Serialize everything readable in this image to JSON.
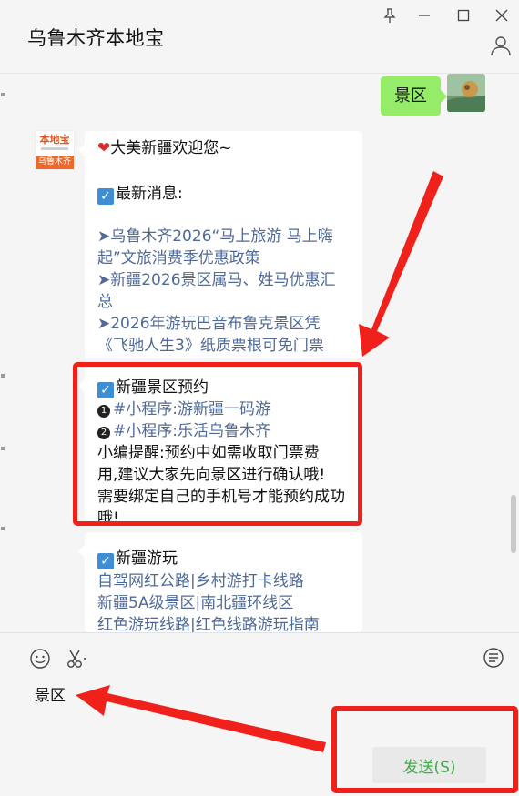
{
  "window": {
    "title": "乌鲁木齐本地宝",
    "controls": [
      "pin-icon",
      "minimize-icon",
      "maximize-icon",
      "close-icon"
    ]
  },
  "my_message": {
    "text": "景区"
  },
  "bot": {
    "avatar": {
      "top_text": "本地宝",
      "band_text": "乌鲁木齐"
    },
    "welcome": "大美新疆欢迎您~",
    "news_header": "最新消息:",
    "news": [
      {
        "line1": "➤乌鲁木齐2026“马上旅游 马上嗨",
        "line2": "起”文旅消费季优惠政策"
      },
      {
        "line1": "➤新疆2026景区属马、姓马优惠汇",
        "line2": "总"
      },
      {
        "line1": "➤2026年游玩巴音布鲁克景区凭",
        "line2": "《飞驰人生3》纸质票根可免门票"
      }
    ],
    "booking": {
      "header": "新疆景区预约",
      "items": [
        {
          "num": "1",
          "text": "#小程序:游新疆一码游"
        },
        {
          "num": "2",
          "text": "#小程序:乐活乌鲁木齐"
        }
      ],
      "tip_lines": [
        "小编提醒:预约中如需收取门票费",
        "用,建议大家先向景区进行确认哦!",
        "需要绑定自己的手机号才能预约成功",
        "哦!"
      ]
    },
    "travel": {
      "header": "新疆游玩",
      "rows": [
        [
          "自驾网红公路",
          "乡村游打卡线路"
        ],
        [
          "新疆5A级景区",
          "南北疆环线区"
        ],
        [
          "红色游玩线路",
          "红色线路游玩指南"
        ]
      ]
    }
  },
  "input": {
    "text": "景区",
    "send_label": "发送(S)"
  },
  "colors": {
    "my_bubble": "#95ec69",
    "link": "#4f6a98",
    "highlight": "#f0211b",
    "send_text": "#3fae48"
  }
}
